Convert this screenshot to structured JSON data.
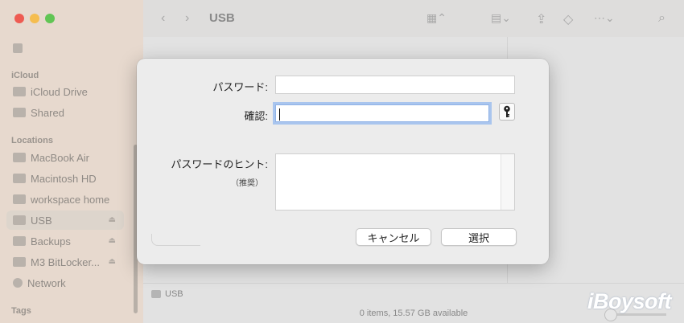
{
  "window": {
    "title": "USB",
    "traffic_colors": [
      "#ee5b52",
      "#f5bd4f",
      "#61c554"
    ]
  },
  "sidebar": {
    "icloud_header": "iCloud",
    "icloud_items": [
      {
        "label": "iCloud Drive",
        "icon": "icloud-icon"
      },
      {
        "label": "Shared",
        "icon": "shared-folder-icon"
      }
    ],
    "locations_header": "Locations",
    "location_items": [
      {
        "label": "MacBook Air",
        "icon": "laptop-icon"
      },
      {
        "label": "Macintosh HD",
        "icon": "disk-icon"
      },
      {
        "label": "workspace home",
        "icon": "disk-icon"
      },
      {
        "label": "USB",
        "icon": "external-disk-icon",
        "selected": true,
        "eject": true
      },
      {
        "label": "Backups",
        "icon": "external-disk-icon",
        "eject": true
      },
      {
        "label": "M3 BitLocker...",
        "icon": "external-disk-icon",
        "eject": true
      },
      {
        "label": "Network",
        "icon": "globe-icon"
      }
    ],
    "tags_header": "Tags"
  },
  "dialog": {
    "password_label": "パスワード:",
    "password_value": "",
    "verify_label": "確認:",
    "verify_value": "",
    "hint_label": "パスワードのヒント:",
    "hint_sublabel": "（推奨）",
    "hint_value": "",
    "cancel_label": "キャンセル",
    "choose_label": "選択"
  },
  "pathbar": {
    "label": "USB"
  },
  "status": {
    "text": "0 items, 15.57 GB available"
  },
  "watermark": "iBoysoft"
}
